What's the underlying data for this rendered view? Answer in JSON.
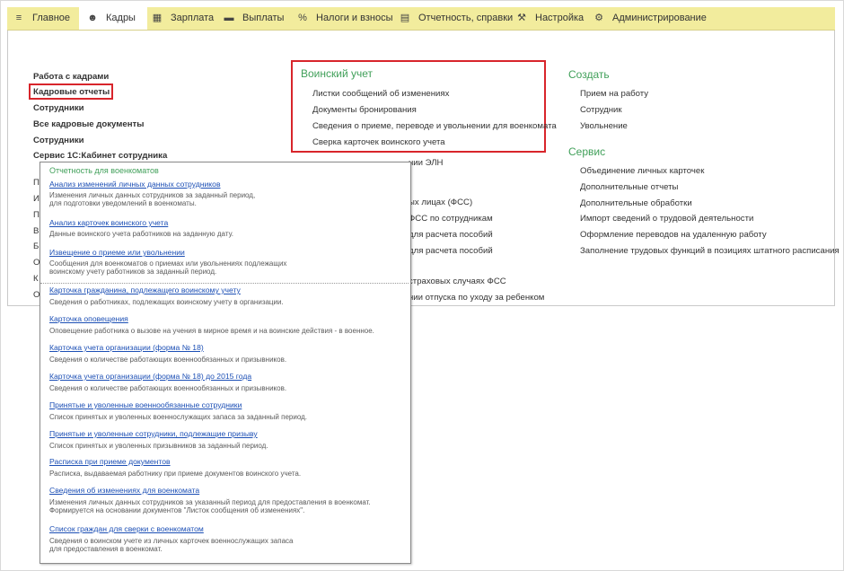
{
  "menu": [
    {
      "label": "Главное",
      "icon": "hamburger-icon",
      "glyph": "≡"
    },
    {
      "label": "Кадры",
      "icon": "people-icon",
      "glyph": "👥",
      "active": true
    },
    {
      "label": "Зарплата",
      "icon": "calculator-icon",
      "glyph": "▦"
    },
    {
      "label": "Выплаты",
      "icon": "wallet-icon",
      "glyph": "▬"
    },
    {
      "label": "Налоги и взносы",
      "icon": "percent-icon",
      "glyph": "%"
    },
    {
      "label": "Отчетность, справки",
      "icon": "documents-icon",
      "glyph": "▤"
    },
    {
      "label": "Настройка",
      "icon": "wrench-icon",
      "glyph": "🔧"
    },
    {
      "label": "Администрирование",
      "icon": "gear-icon",
      "glyph": "⚙"
    }
  ],
  "left": {
    "items": [
      "Работа с кадрами",
      "Кадровые отчеты",
      "Сотрудники",
      "Все кадровые документы",
      "Сотрудники",
      "Сервис 1С:Кабинет сотрудника"
    ],
    "letters": [
      "П",
      "И",
      "П",
      "В",
      "Б",
      "О",
      "К",
      "О"
    ]
  },
  "military": {
    "title": "Воинский учет",
    "items": [
      "Листки сообщений об изменениях",
      "Документы бронирования",
      "Сведения о приеме, переводе и увольнении для военкомата",
      "Сверка карточек воинского учета"
    ]
  },
  "middle_fragments": [
    "нии ЭЛН",
    "ых лицах (ФСС)",
    "ФСС по сотрудникам",
    "для расчета пособий",
    "для расчета пособий",
    "страховых случаях ФСС",
    "нии отпуска по уходу за ребенком"
  ],
  "create": {
    "title": "Создать",
    "items": [
      "Прием на работу",
      "Сотрудник",
      "Увольнение"
    ]
  },
  "service": {
    "title": "Сервис",
    "items": [
      "Объединение личных карточек",
      "Дополнительные отчеты",
      "Дополнительные обработки",
      "Импорт сведений о трудовой деятельности",
      "Оформление переводов на удаленную работу",
      "Заполнение трудовых функций в позициях штатного расписания"
    ]
  },
  "popup": {
    "header": "Отчетность для военкоматов",
    "reports": [
      {
        "link": "Анализ изменений личных данных сотрудников",
        "desc": [
          "Изменения личных данных сотрудников за заданный период,",
          "для подготовки уведомлений в военкоматы."
        ]
      },
      {
        "link": "Анализ карточек воинского учета",
        "desc": [
          "Данные воинского учета работников на заданную дату."
        ]
      },
      {
        "link": "Извещение о приеме или увольнении",
        "desc": [
          "Сообщения для военкоматов о приемах или увольнениях подлежащих",
          "воинскому учету работников за заданный период."
        ]
      },
      {
        "link": "Карточка гражданина, подлежащего воинскому учету",
        "desc": [
          "Сведения о работниках, подлежащих воинскому учету в организации."
        ]
      },
      {
        "link": "Карточка оповещения",
        "desc": [
          "Оповещение работника о вызове на учения в мирное время и на воинские действия - в военное."
        ]
      },
      {
        "link": "Карточка учета организации (форма № 18)",
        "desc": [
          "Сведения о количестве работающих военнообязанных и призывников."
        ]
      },
      {
        "link": "Карточка учета организации (форма № 18) до 2015 года",
        "desc": [
          "Сведения о количестве работающих военнообязанных и призывников."
        ]
      },
      {
        "link": "Принятые и уволенные военнообязанные сотрудники",
        "desc": [
          "Список принятых и уволенных военнослужащих запаса за заданный период."
        ]
      },
      {
        "link": "Принятые и уволенные сотрудники, подлежащие призыву",
        "desc": [
          "Список принятых и уволенных призывников за заданный период."
        ]
      },
      {
        "link": "Расписка при приеме документов",
        "desc": [
          "Расписка, выдаваемая работнику при приеме документов воинского учета."
        ]
      },
      {
        "link": "Сведения об изменениях для военкомата",
        "desc": [
          "Изменения личных данных сотрудников за указанный период для предоставления в военкомат.",
          "Формируется на основании документов \"Листок сообщения об изменениях\"."
        ]
      },
      {
        "link": "Список граждан для сверки с военкоматом",
        "desc": [
          "Сведения о воинском учете из личных карточек военнослужащих запаса",
          "для предоставления в военкомат."
        ]
      }
    ]
  },
  "colors": {
    "menubar": "#f2ec9d",
    "section": "#41a05a",
    "link": "#1c4fb5",
    "highlight": "#d8252b"
  }
}
